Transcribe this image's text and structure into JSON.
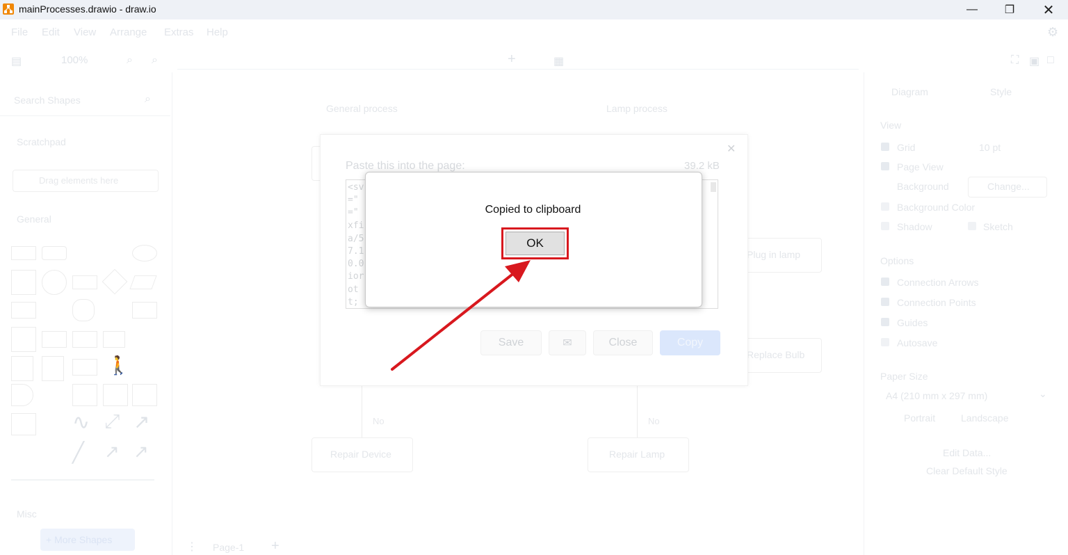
{
  "window": {
    "title": "mainProcesses.drawio - draw.io",
    "minimize_icon": "minimize-icon",
    "restore_icon": "restore-icon",
    "close_icon": "close-icon"
  },
  "menu": {
    "items": [
      "File",
      "Edit",
      "View",
      "Arrange",
      "Extras",
      "Help"
    ]
  },
  "toolbar": {
    "zoom": "100%"
  },
  "sidebar": {
    "search_placeholder": "Search Shapes",
    "scratchpad_title": "Scratchpad",
    "scratchpad_drop": "Drag elements here",
    "general_title": "General",
    "misc_title": "Misc",
    "more_shapes": "+ More Shapes"
  },
  "canvas": {
    "general_process_label": "General process",
    "lamp_process_label": "Lamp process",
    "plug_in_lamp": "Plug in lamp",
    "replace_bulb": "Replace Bulb",
    "no_left": "No",
    "no_right": "No",
    "repair_device": "Repair Device",
    "repair_lamp": "Repair Lamp",
    "page_tab": "Page-1"
  },
  "format_panel": {
    "tab_diagram": "Diagram",
    "tab_style": "Style",
    "view_title": "View",
    "grid": "Grid",
    "grid_size": "10 pt",
    "page_view": "Page View",
    "background": "Background",
    "change": "Change...",
    "background_color": "Background Color",
    "shadow": "Shadow",
    "sketch": "Sketch",
    "options_title": "Options",
    "connection_arrows": "Connection Arrows",
    "connection_points": "Connection Points",
    "guides": "Guides",
    "autosave": "Autosave",
    "paper_size_title": "Paper Size",
    "paper_size_value": "A4 (210 mm x 297 mm)",
    "portrait": "Portrait",
    "landscape": "Landscape",
    "edit_data": "Edit Data...",
    "clear_default_style": "Clear Default Style"
  },
  "export_dialog": {
    "paste_label": "Paste this into the page:",
    "size": "39.2 kB",
    "xml_lines": [
      "<sv",
      "=\"",
      "=\"",
      "xfi",
      "a/5",
      "7.1",
      "0.0",
      "ior",
      "ot",
      "t; "
    ],
    "save": "Save",
    "mail_icon": "mail-icon",
    "close": "Close",
    "copy": "Copy"
  },
  "alert": {
    "message": "Copied to clipboard",
    "ok": "OK"
  },
  "annotation": {
    "highlight_color": "#d8181e",
    "arrow_color": "#d8181e"
  }
}
